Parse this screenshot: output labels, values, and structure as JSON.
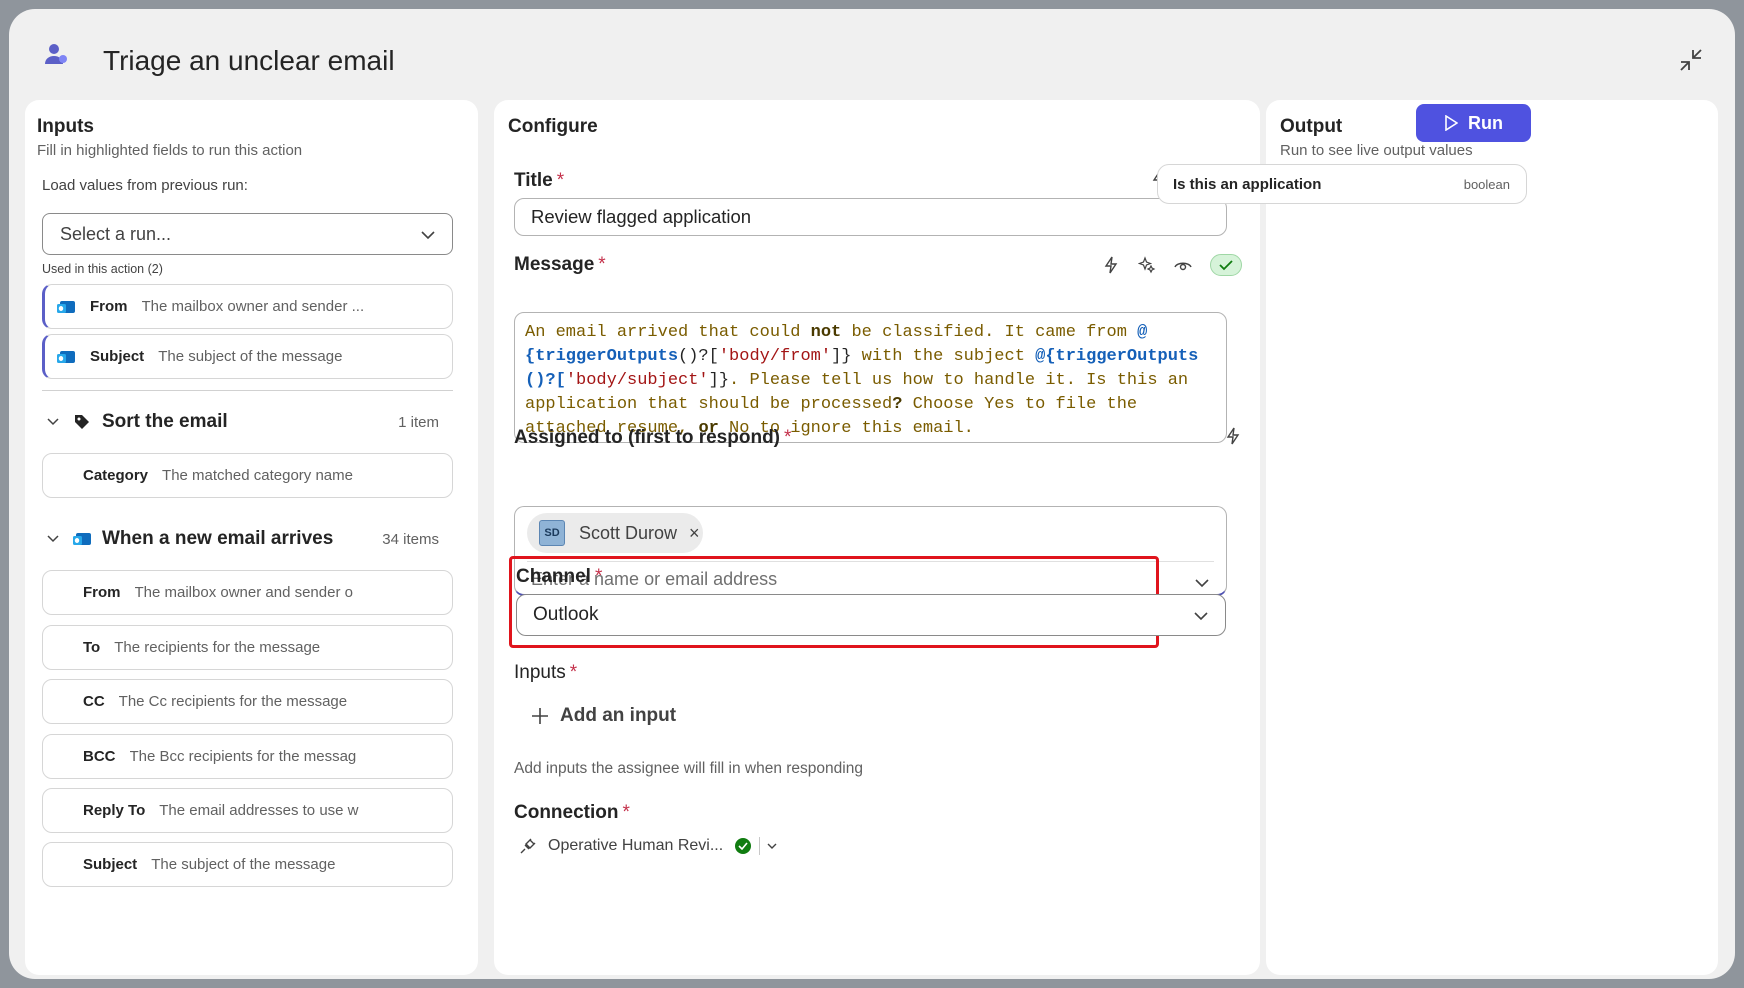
{
  "modal": {
    "title": "Triage an unclear email"
  },
  "inputs_panel": {
    "heading": "Inputs",
    "subtitle": "Fill in highlighted fields to run this action",
    "load_label": "Load values from previous run:",
    "select_placeholder": "Select a run...",
    "used_label": "Used in this action (2)",
    "used_items": [
      {
        "name": "From",
        "description": "The mailbox owner and sender ...",
        "icon": "outlook-icon"
      },
      {
        "name": "Subject",
        "description": "The subject of the message",
        "icon": "outlook-icon"
      }
    ],
    "groups": [
      {
        "title": "Sort the email",
        "count": "1 item",
        "icon": "tag-icon",
        "items": [
          {
            "name": "Category",
            "description": "The matched category name"
          }
        ]
      },
      {
        "title": "When a new email arrives",
        "count": "34 items",
        "icon": "outlook-icon",
        "items": [
          {
            "name": "From",
            "description": "The mailbox owner and sender o"
          },
          {
            "name": "To",
            "description": "The recipients for the message"
          },
          {
            "name": "CC",
            "description": "The Cc recipients for the message"
          },
          {
            "name": "BCC",
            "description": "The Bcc recipients for the messag"
          },
          {
            "name": "Reply To",
            "description": "The email addresses to use w"
          },
          {
            "name": "Subject",
            "description": "The subject of the message"
          }
        ]
      }
    ]
  },
  "configure_panel": {
    "heading": "Configure",
    "title_field": {
      "label": "Title",
      "required": "*",
      "value": "Review flagged application"
    },
    "message_field": {
      "label": "Message",
      "required": "*"
    },
    "message_segments": [
      "An email arrived that could ",
      "not",
      " be classified. It came from ",
      "@",
      "{",
      "triggerOutputs",
      "()?[",
      "'body/from'",
      "]}",
      " with the subject ",
      "@",
      "{",
      "triggerOutputs",
      "()?[",
      "'body/subject'",
      "]}",
      ". Please tell us how to handle it. Is this an application that should be processed",
      "?",
      " Choose Yes to file the attached resume, ",
      "or",
      " No to ignore this email."
    ],
    "assigned_field": {
      "label": "Assigned to (first to respond)",
      "required": "*",
      "person_initials": "SD",
      "person_name": "Scott Durow",
      "remove_glyph": "×",
      "placeholder": "Enter a name or email address"
    },
    "channel_field": {
      "label": "Channel",
      "required": "*",
      "value": "Outlook"
    },
    "inputs_field": {
      "label": "Inputs",
      "required": "*",
      "add_label": "Add an input",
      "help": "Add inputs the assignee will fill in when responding"
    },
    "connection_field": {
      "label": "Connection",
      "required": "*",
      "value": "Operative Human Revi..."
    }
  },
  "output_panel": {
    "heading": "Output",
    "subtitle": "Run to see live output values",
    "run_label": "Run",
    "outputs": [
      {
        "name": "Is this an application",
        "type": "boolean"
      }
    ]
  },
  "colors": {
    "accent": "#4f52e0",
    "required": "#c4314b",
    "highlight_frame": "#e0141c",
    "success": "#107c10"
  }
}
